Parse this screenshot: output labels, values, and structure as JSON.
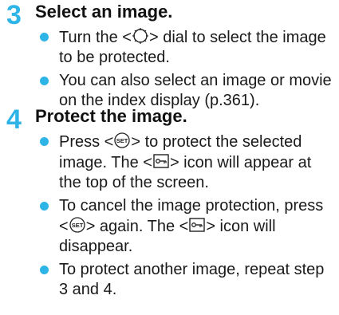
{
  "colors": {
    "accent": "#2eb4e6"
  },
  "step3": {
    "number": "3",
    "title": "Select an image.",
    "bullet1": {
      "a": "Turn the <",
      "icon": "main-dial-icon",
      "b": "> dial to select the image to be protected."
    },
    "bullet2": {
      "text": "You can also select an image or movie on the index display (p.361)."
    }
  },
  "step4": {
    "number": "4",
    "title": "Protect the image.",
    "bullet1": {
      "a": "Press <",
      "icon": "set-button-icon",
      "b": "> to protect the selected image. The <",
      "icon2": "protect-key-icon",
      "c": "> icon will appear at the top of the screen."
    },
    "bullet2": {
      "a": "To cancel the image protection, press <",
      "icon": "set-button-icon",
      "b": "> again. The <",
      "icon2": "protect-key-icon",
      "c": "> icon will disappear."
    },
    "bullet3": {
      "text": "To protect another image, repeat step 3 and 4."
    }
  }
}
